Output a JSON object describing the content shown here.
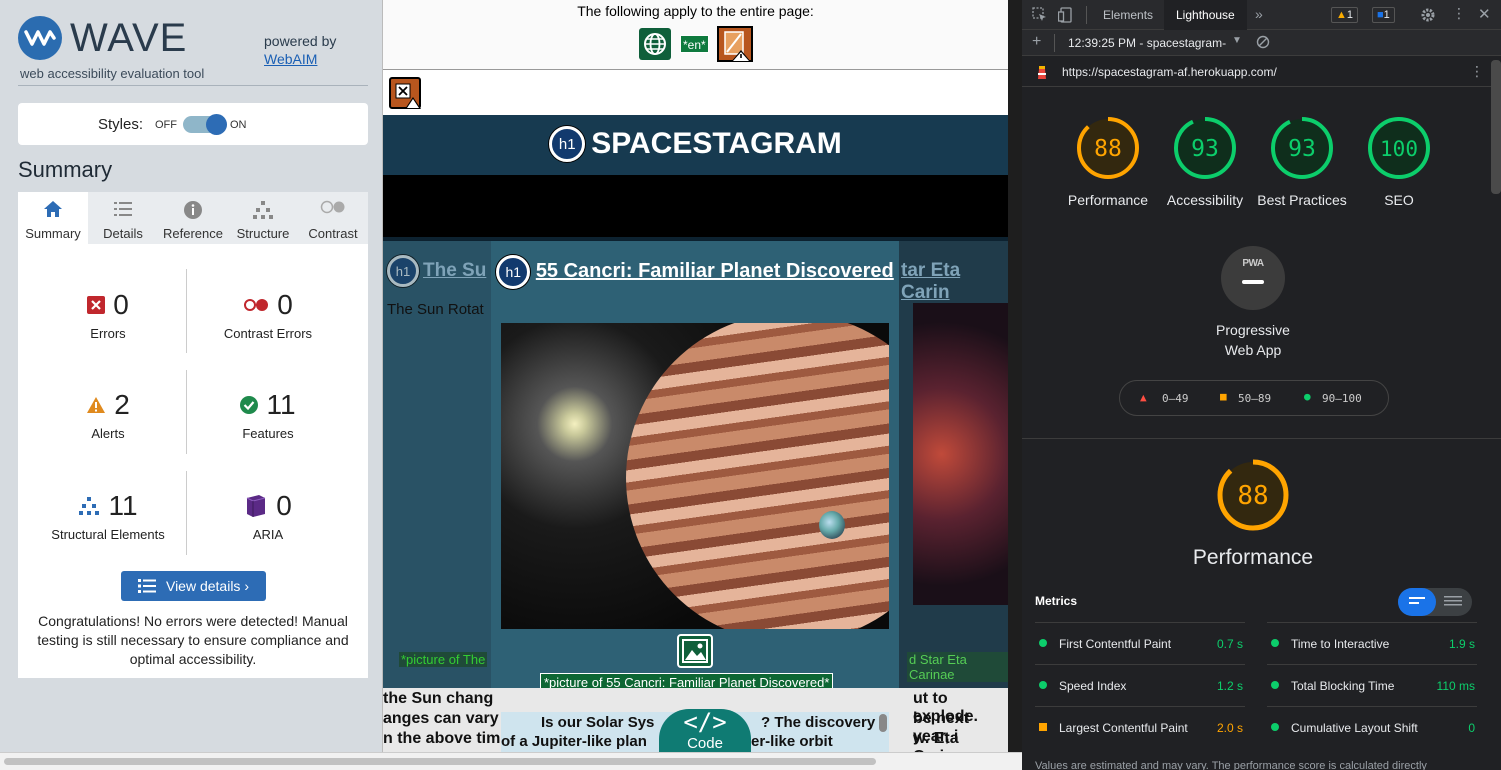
{
  "wave": {
    "logo_word": "WAVE",
    "subtitle": "web accessibility evaluation tool",
    "powered_by": "powered by",
    "webaim_link": "WebAIM",
    "styles_label": "Styles:",
    "styles_off": "OFF",
    "styles_on": "ON",
    "styles_state": "on",
    "summary_heading": "Summary",
    "tabs": [
      {
        "label": "Summary",
        "icon": "home-icon",
        "active": true
      },
      {
        "label": "Details",
        "icon": "list-icon",
        "active": false
      },
      {
        "label": "Reference",
        "icon": "info-icon",
        "active": false
      },
      {
        "label": "Structure",
        "icon": "structure-icon",
        "active": false
      },
      {
        "label": "Contrast",
        "icon": "contrast-icon",
        "active": false
      }
    ],
    "stats": {
      "errors": {
        "count": "0",
        "label": "Errors"
      },
      "contrast_errors": {
        "count": "0",
        "label": "Contrast Errors"
      },
      "alerts": {
        "count": "2",
        "label": "Alerts"
      },
      "features": {
        "count": "11",
        "label": "Features"
      },
      "structural": {
        "count": "11",
        "label": "Structural Elements"
      },
      "aria": {
        "count": "0",
        "label": "ARIA"
      }
    },
    "view_details": "View details ›",
    "congrats": "Congratulations! No errors were detected! Manual testing is still necessary to ensure compliance and optimal accessibility."
  },
  "preview": {
    "apply_text": "The following apply to the entire page:",
    "lang_badge": "*en*",
    "site_title": "SPACESTAGRAM",
    "h1_badge": "h1",
    "left_card_title": "The Su",
    "left_card_text": "The Sun Rotat",
    "right_card_title": "tar Eta Carin",
    "modal_title": "55 Cancri: Familiar Planet Discovered",
    "alt_text": "*picture of 55 Cancri: Familiar Planet Discovered*",
    "left_alt": "*picture of The",
    "right_alt": "d Star Eta Carinae",
    "body_line1_left": "the Sun chang",
    "body_line1_right": "ut to explode.",
    "body_line2_left": "anges can vary",
    "body_line2_right": "be next year, i",
    "body_line3_left": "n the above tim",
    "body_line3_right": "w. Eta Carinae",
    "inner_line1": "Is our Solar Sys",
    "inner_line1b": "? The discovery",
    "inner_line2": "of a Jupiter-like plan",
    "inner_line2b": "er-like orbit",
    "code_label": "Code",
    "code_symbol": "</>"
  },
  "devtools": {
    "tabs": [
      "Elements",
      "Lighthouse"
    ],
    "active_tab": "Lighthouse",
    "warn_count": "1",
    "msg_count": "1",
    "report_time": "12:39:25 PM - spacestagram-",
    "url": "https://spacestagram-af.herokuapp.com/",
    "scores": [
      {
        "value": "88",
        "label": "Performance",
        "color": "#ffa400"
      },
      {
        "value": "93",
        "label": "Accessibility",
        "color": "#0cce6b"
      },
      {
        "value": "93",
        "label": "Best Practices",
        "color": "#0cce6b"
      },
      {
        "value": "100",
        "label": "SEO",
        "color": "#0cce6b"
      }
    ],
    "pwa_badge": "PWA",
    "pwa_label": "Progressive Web App",
    "legend": [
      {
        "range": "0–49",
        "color": "#ff4e42"
      },
      {
        "range": "50–89",
        "color": "#ffa400"
      },
      {
        "range": "90–100",
        "color": "#0cce6b"
      }
    ],
    "perf_score": "88",
    "perf_heading": "Performance",
    "metrics_heading": "Metrics",
    "metrics": [
      {
        "name": "First Contentful Paint",
        "value": "0.7 s",
        "status": "pass"
      },
      {
        "name": "Time to Interactive",
        "value": "1.9 s",
        "status": "pass"
      },
      {
        "name": "Speed Index",
        "value": "1.2 s",
        "status": "pass"
      },
      {
        "name": "Total Blocking Time",
        "value": "110 ms",
        "status": "pass"
      },
      {
        "name": "Largest Contentful Paint",
        "value": "2.0 s",
        "status": "average"
      },
      {
        "name": "Cumulative Layout Shift",
        "value": "0",
        "status": "pass"
      }
    ],
    "footer": "Values are estimated and may vary. The performance score is calculated directly",
    "colors": {
      "pass": "#0cce6b",
      "average": "#ffa400",
      "fail": "#ff4e42"
    }
  }
}
